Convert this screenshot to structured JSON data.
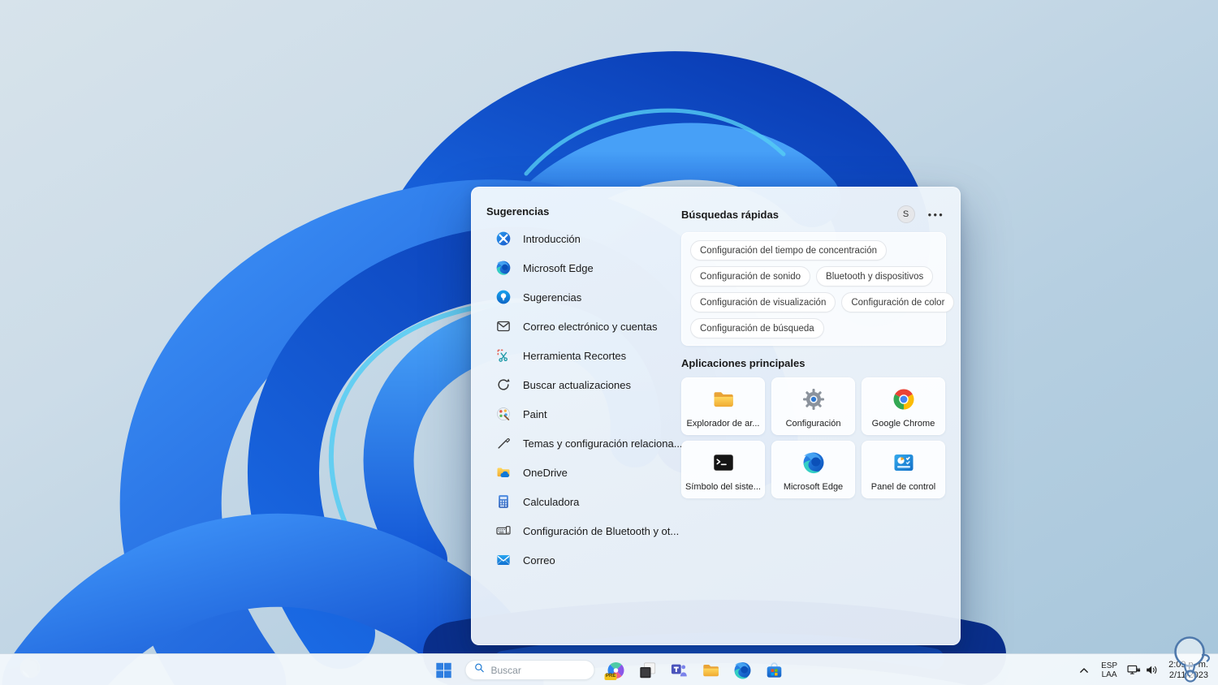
{
  "panel": {
    "suggestions": {
      "title": "Sugerencias",
      "items": [
        {
          "label": "Introducción",
          "icon": "get-started-icon"
        },
        {
          "label": "Microsoft Edge",
          "icon": "edge-icon"
        },
        {
          "label": "Sugerencias",
          "icon": "tips-icon"
        },
        {
          "label": "Correo electrónico y cuentas",
          "icon": "mail-outline-icon"
        },
        {
          "label": "Herramienta Recortes",
          "icon": "snipping-tool-icon"
        },
        {
          "label": "Buscar actualizaciones",
          "icon": "refresh-icon"
        },
        {
          "label": "Paint",
          "icon": "paint-icon"
        },
        {
          "label": "Temas y configuración relaciona...",
          "icon": "pen-icon"
        },
        {
          "label": "OneDrive",
          "icon": "onedrive-icon"
        },
        {
          "label": "Calculadora",
          "icon": "calculator-icon"
        },
        {
          "label": "Configuración de Bluetooth y ot...",
          "icon": "devices-icon"
        },
        {
          "label": "Correo",
          "icon": "mail-app-icon"
        }
      ]
    },
    "quick_searches": {
      "title": "Búsquedas rápidas",
      "chips": [
        "Configuración del tiempo de concentración",
        "Configuración de sonido",
        "Bluetooth y dispositivos",
        "Configuración de visualización",
        "Configuración de color",
        "Configuración de búsqueda"
      ]
    },
    "top_apps": {
      "title": "Aplicaciones principales",
      "tiles": [
        {
          "label": "Explorador de ar...",
          "icon": "file-explorer-icon"
        },
        {
          "label": "Configuración",
          "icon": "settings-gear-icon"
        },
        {
          "label": "Google Chrome",
          "icon": "chrome-icon"
        },
        {
          "label": "Símbolo del siste...",
          "icon": "command-prompt-icon"
        },
        {
          "label": "Microsoft Edge",
          "icon": "edge-icon"
        },
        {
          "label": "Panel de control",
          "icon": "control-panel-icon"
        }
      ]
    },
    "account_initial": "S",
    "more_label": "●●●"
  },
  "taskbar": {
    "search_placeholder": "Buscar",
    "copilot_badge": "PRE",
    "tray": {
      "language_line1": "ESP",
      "language_line2": "LAA",
      "time": "2:09 p. m.",
      "date": "2/11/2023"
    }
  },
  "colors": {
    "accent": "#0b63c9",
    "bloom_blue": "#1668e3",
    "folder_yellow": "#f6c64a"
  }
}
